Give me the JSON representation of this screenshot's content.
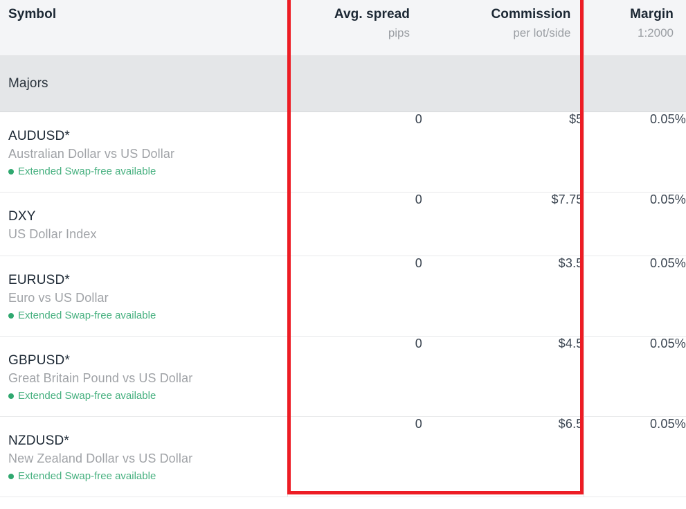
{
  "table": {
    "columns": [
      {
        "key": "symbol",
        "title": "Symbol",
        "sub": "",
        "align": "left"
      },
      {
        "key": "spread",
        "title": "Avg. spread",
        "sub": "pips",
        "align": "right"
      },
      {
        "key": "commission",
        "title": "Commission",
        "sub": "per lot/side",
        "align": "right"
      },
      {
        "key": "margin",
        "title": "Margin",
        "sub": "1:2000",
        "align": "right"
      }
    ],
    "group": {
      "label": "Majors"
    },
    "swap_free_label": "Extended Swap-free available",
    "rows": [
      {
        "code": "AUDUSD*",
        "description": "Australian Dollar vs US Dollar",
        "swap_free": "Extended Swap-free available",
        "spread": "0",
        "commission": "$5",
        "margin": "0.05%"
      },
      {
        "code": "DXY",
        "description": "US Dollar Index",
        "swap_free": "",
        "spread": "0",
        "commission": "$7.75",
        "margin": "0.05%"
      },
      {
        "code": "EURUSD*",
        "description": "Euro vs US Dollar",
        "swap_free": "Extended Swap-free available",
        "spread": "0",
        "commission": "$3.5",
        "margin": "0.05%"
      },
      {
        "code": "GBPUSD*",
        "description": "Great Britain Pound vs US Dollar",
        "swap_free": "Extended Swap-free available",
        "spread": "0",
        "commission": "$4.5",
        "margin": "0.05%"
      },
      {
        "code": "NZDUSD*",
        "description": "New Zealand Dollar vs US Dollar",
        "swap_free": "Extended Swap-free available",
        "spread": "0",
        "commission": "$6.5",
        "margin": "0.05%"
      }
    ]
  },
  "annotation": {
    "type": "rectangle-highlight",
    "color": "#ed1c24",
    "covers": "Avg. spread and Commission columns"
  },
  "colors": {
    "header_bg": "#f4f5f7",
    "group_bg": "#e4e6e8",
    "row_bg": "#ffffff",
    "text_primary": "#1b2733",
    "text_muted": "#a0a3a7",
    "accent_green": "#46b07f",
    "annotation_red": "#ed1c24"
  }
}
